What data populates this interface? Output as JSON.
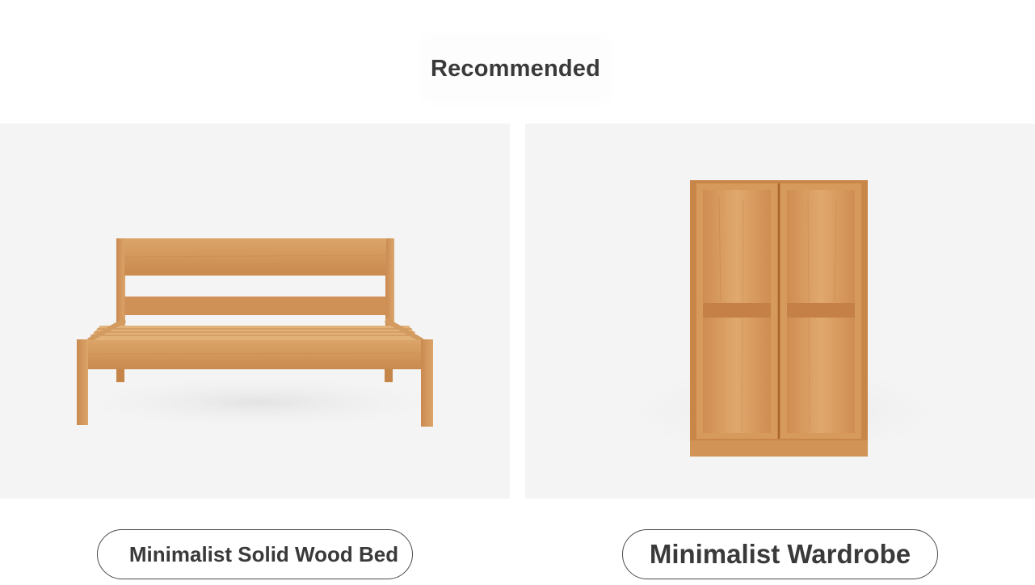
{
  "section": {
    "title": "Recommended"
  },
  "products": [
    {
      "name": "Minimalist Solid Wood Bed",
      "image_icon": "wood-bed-image"
    },
    {
      "name": "Minimalist Wardrobe",
      "image_icon": "wardrobe-image"
    }
  ],
  "colors": {
    "image_background": "#f4f4f4",
    "wood": "#d79a5d",
    "wood_dark": "#b57640",
    "text": "#3a3a3a",
    "pill_border": "#4a4a4a"
  }
}
